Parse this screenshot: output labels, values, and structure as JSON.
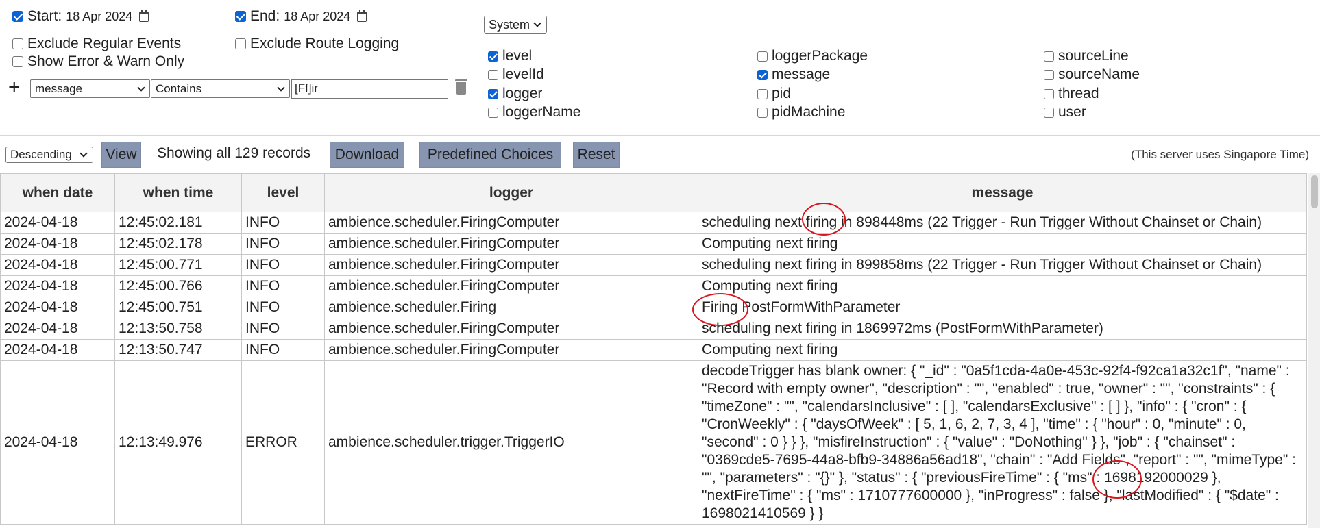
{
  "filters": {
    "start_label": "Start:",
    "start_date": "18 Apr 2024",
    "end_label": "End:",
    "end_date": "18 Apr 2024",
    "exclude_regular": "Exclude Regular Events",
    "exclude_route": "Exclude Route Logging",
    "error_warn_only": "Show Error & Warn Only",
    "condition": {
      "field": "message",
      "operator": "Contains",
      "value": "[Ff]ir"
    }
  },
  "columns_panel": {
    "group_select": "System",
    "fields": [
      {
        "label": "level",
        "checked": true
      },
      {
        "label": "levelId",
        "checked": false
      },
      {
        "label": "logger",
        "checked": true
      },
      {
        "label": "loggerName",
        "checked": false
      },
      {
        "label": "loggerPackage",
        "checked": false
      },
      {
        "label": "message",
        "checked": true
      },
      {
        "label": "pid",
        "checked": false
      },
      {
        "label": "pidMachine",
        "checked": false
      },
      {
        "label": "sourceLine",
        "checked": false
      },
      {
        "label": "sourceName",
        "checked": false
      },
      {
        "label": "thread",
        "checked": false
      },
      {
        "label": "user",
        "checked": false
      }
    ]
  },
  "toolbar": {
    "sort": "Descending",
    "view": "View",
    "records": "Showing all 129 records",
    "download": "Download",
    "predefined": "Predefined Choices",
    "reset": "Reset",
    "timezone_note": "(This server uses Singapore Time)"
  },
  "table": {
    "headers": {
      "date": "when date",
      "time": "when time",
      "level": "level",
      "logger": "logger",
      "message": "message"
    },
    "rows": [
      {
        "date": "2024-04-18",
        "time": "12:45:02.181",
        "level": "INFO",
        "logger": "ambience.scheduler.FiringComputer",
        "message": "scheduling next firing in 898448ms (22 Trigger - Run Trigger Without Chainset or Chain)"
      },
      {
        "date": "2024-04-18",
        "time": "12:45:02.178",
        "level": "INFO",
        "logger": "ambience.scheduler.FiringComputer",
        "message": "Computing next firing"
      },
      {
        "date": "2024-04-18",
        "time": "12:45:00.771",
        "level": "INFO",
        "logger": "ambience.scheduler.FiringComputer",
        "message": "scheduling next firing in 899858ms (22 Trigger - Run Trigger Without Chainset or Chain)"
      },
      {
        "date": "2024-04-18",
        "time": "12:45:00.766",
        "level": "INFO",
        "logger": "ambience.scheduler.FiringComputer",
        "message": "Computing next firing"
      },
      {
        "date": "2024-04-18",
        "time": "12:45:00.751",
        "level": "INFO",
        "logger": "ambience.scheduler.Firing",
        "message": "Firing PostFormWithParameter"
      },
      {
        "date": "2024-04-18",
        "time": "12:13:50.758",
        "level": "INFO",
        "logger": "ambience.scheduler.FiringComputer",
        "message": "scheduling next firing in 1869972ms (PostFormWithParameter)"
      },
      {
        "date": "2024-04-18",
        "time": "12:13:50.747",
        "level": "INFO",
        "logger": "ambience.scheduler.FiringComputer",
        "message": "Computing next firing"
      },
      {
        "date": "2024-04-18",
        "time": "12:13:49.976",
        "level": "ERROR",
        "logger": "ambience.scheduler.trigger.TriggerIO",
        "message": "decodeTrigger has blank owner: { \"_id\" : \"0a5f1cda-4a0e-453c-92f4-f92ca1a32c1f\", \"name\" : \"Record with empty owner\", \"description\" : \"\", \"enabled\" : true, \"owner\" : \"\", \"constraints\" : { \"timeZone\" : \"\", \"calendarsInclusive\" : [ ], \"calendarsExclusive\" : [ ] }, \"info\" : { \"cron\" : { \"CronWeekly\" : { \"daysOfWeek\" : [ 5, 1, 6, 2, 7, 3, 4 ], \"time\" : { \"hour\" : 0, \"minute\" : 0, \"second\" : 0 } } }, \"misfireInstruction\" : { \"value\" : \"DoNothing\" } }, \"job\" : { \"chainset\" : \"0369cde5-7695-44a8-bfb9-34886a56ad18\", \"chain\" : \"Add Fields\", \"report\" : \"\", \"mimeType\" : \"\", \"parameters\" : \"{}\" }, \"status\" : { \"previousFireTime\" : { \"ms\" : 1698192000029 }, \"nextFireTime\" : { \"ms\" : 1710777600000 }, \"inProgress\" : false }, \"lastModified\" : { \"$date\" : 1698021410569 } }"
      }
    ]
  }
}
